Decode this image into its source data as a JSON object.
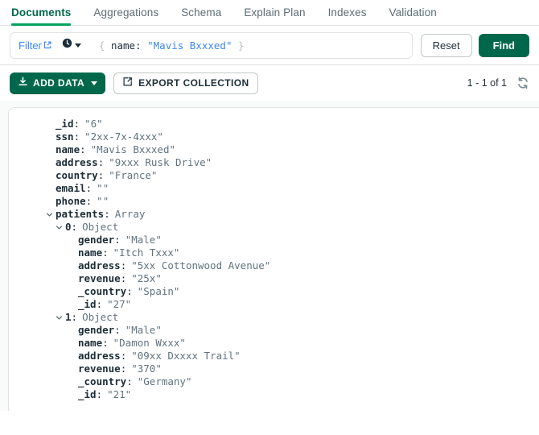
{
  "tabs": [
    {
      "label": "Documents",
      "active": true
    },
    {
      "label": "Aggregations",
      "active": false
    },
    {
      "label": "Schema",
      "active": false
    },
    {
      "label": "Explain Plan",
      "active": false
    },
    {
      "label": "Indexes",
      "active": false
    },
    {
      "label": "Validation",
      "active": false
    }
  ],
  "query_bar": {
    "filter_label": "Filter",
    "filter_open_brace": "{",
    "filter_close_brace": "}",
    "filter_key": "name:",
    "filter_value": "\"Mavis Bxxxed\"",
    "reset_label": "Reset",
    "find_label": "Find"
  },
  "toolbar": {
    "add_data_label": "ADD DATA",
    "export_collection_label": "EXPORT COLLECTION",
    "count_label": "1 - 1 of 1"
  },
  "colors": {
    "brand_green": "#00684A",
    "accent_green": "#00A35C",
    "link_blue": "#3D85F5",
    "value_gray": "#60737F",
    "border": "#E1E2E4"
  },
  "document": {
    "fields": [
      {
        "indent": 0,
        "expandable": false,
        "key": "_id",
        "value": "\"6\""
      },
      {
        "indent": 0,
        "expandable": false,
        "key": "ssn",
        "value": "\"2xx-7x-4xxx\""
      },
      {
        "indent": 0,
        "expandable": false,
        "key": "name",
        "value": "\"Mavis Bxxxed\""
      },
      {
        "indent": 0,
        "expandable": false,
        "key": "address",
        "value": "\"9xxx Rusk Drive\""
      },
      {
        "indent": 0,
        "expandable": false,
        "key": "country",
        "value": "\"France\""
      },
      {
        "indent": 0,
        "expandable": false,
        "key": "email",
        "value": "\"\""
      },
      {
        "indent": 0,
        "expandable": false,
        "key": "phone",
        "value": "\"\""
      },
      {
        "indent": 0,
        "expandable": true,
        "key": "patients",
        "value": "Array"
      },
      {
        "indent": 1,
        "expandable": true,
        "key": "0",
        "value": "Object"
      },
      {
        "indent": 2,
        "expandable": false,
        "key": "gender",
        "value": "\"Male\""
      },
      {
        "indent": 2,
        "expandable": false,
        "key": "name",
        "value": "\"Itch Txxx\""
      },
      {
        "indent": 2,
        "expandable": false,
        "key": "address",
        "value": "\"5xx Cottonwood Avenue\""
      },
      {
        "indent": 2,
        "expandable": false,
        "key": "revenue",
        "value": "\"25x\""
      },
      {
        "indent": 2,
        "expandable": false,
        "key": "_country",
        "value": "\"Spain\""
      },
      {
        "indent": 2,
        "expandable": false,
        "key": "_id",
        "value": "\"27\""
      },
      {
        "indent": 1,
        "expandable": true,
        "key": "1",
        "value": "Object"
      },
      {
        "indent": 2,
        "expandable": false,
        "key": "gender",
        "value": "\"Male\""
      },
      {
        "indent": 2,
        "expandable": false,
        "key": "name",
        "value": "\"Damon Wxxx\""
      },
      {
        "indent": 2,
        "expandable": false,
        "key": "address",
        "value": "\"09xx Dxxxx Trail\""
      },
      {
        "indent": 2,
        "expandable": false,
        "key": "revenue",
        "value": "\"370\""
      },
      {
        "indent": 2,
        "expandable": false,
        "key": "_country",
        "value": "\"Germany\""
      },
      {
        "indent": 2,
        "expandable": false,
        "key": "_id",
        "value": "\"21\""
      }
    ]
  },
  "icons": {
    "external_link": "external-link-icon",
    "history_clock": "clock-icon",
    "download": "download-icon",
    "export": "export-icon",
    "refresh": "refresh-icon",
    "chevron_down": "chevron-down-icon"
  }
}
